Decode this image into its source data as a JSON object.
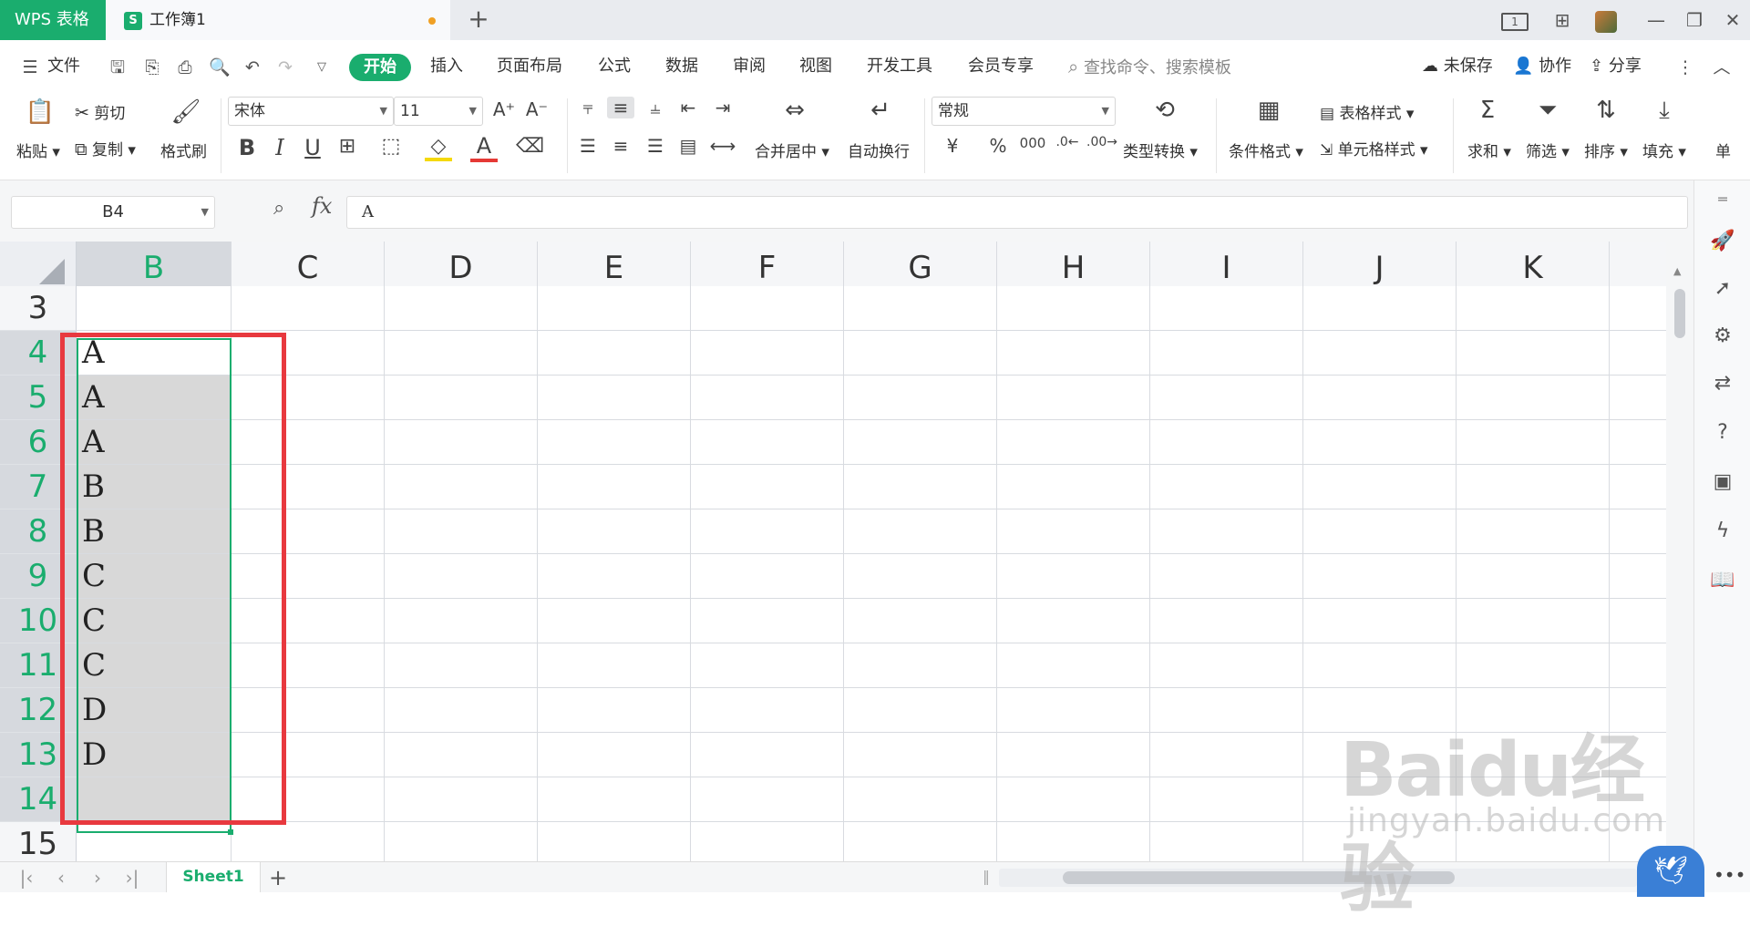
{
  "titlebar": {
    "app_name": "WPS 表格",
    "doc_icon_letter": "S",
    "doc_name": "工作簿1",
    "new_tab": "+",
    "right_controls": [
      "1",
      "⊞",
      "",
      "—",
      "❐",
      "✕"
    ]
  },
  "menubar": {
    "file": "文件",
    "tabs": [
      "开始",
      "插入",
      "页面布局",
      "公式",
      "数据",
      "审阅",
      "视图",
      "开发工具",
      "会员专享"
    ],
    "active_tab": "开始",
    "search": "查找命令、搜索模板",
    "unsaved": "未保存",
    "collab": "协作",
    "share": "分享"
  },
  "ribbon": {
    "paste": "粘贴",
    "cut": "剪切",
    "copy": "复制",
    "format_painter": "格式刷",
    "font_name": "宋体",
    "font_size": "11",
    "merge_center": "合并居中",
    "wrap_text": "自动换行",
    "number_format": "常规",
    "type_convert": "类型转换",
    "conditional_format": "条件格式",
    "table_style": "表格样式",
    "cell_style": "单元格样式",
    "sum": "求和",
    "filter": "筛选",
    "sort": "排序",
    "fill": "填充",
    "cell": "单"
  },
  "formula": {
    "name_box": "B4",
    "fx": "fx",
    "content": "A"
  },
  "grid": {
    "columns": [
      "B",
      "C",
      "D",
      "E",
      "F",
      "G",
      "H",
      "I",
      "J",
      "K"
    ],
    "selected_column": "B",
    "rows": [
      "3",
      "4",
      "5",
      "6",
      "7",
      "8",
      "9",
      "10",
      "11",
      "12",
      "13",
      "14",
      "15"
    ],
    "selected_rows": [
      "4",
      "5",
      "6",
      "7",
      "8",
      "9",
      "10",
      "11",
      "12",
      "13",
      "14"
    ],
    "b_values": [
      "",
      "A",
      "A",
      "A",
      "B",
      "B",
      "C",
      "C",
      "C",
      "D",
      "D",
      "",
      ""
    ],
    "active_cell": "B4"
  },
  "sheets": {
    "tabs": [
      "Sheet1"
    ],
    "add": "+"
  },
  "watermark": {
    "logo": "Baidu经验",
    "url": "jingyan.baidu.com"
  },
  "colors": {
    "accent": "#1aad6e",
    "highlight_box": "#e8393f",
    "range_fill": "#d8d8d8"
  }
}
